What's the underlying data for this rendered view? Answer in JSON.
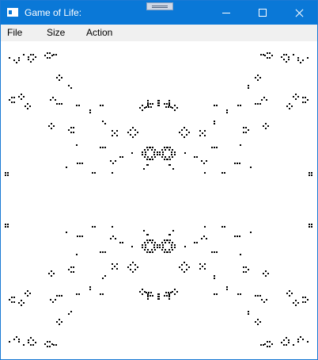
{
  "window": {
    "title": "Game of Life:"
  },
  "menu": {
    "items": [
      "File",
      "Size",
      "Action"
    ]
  },
  "colors": {
    "titlebar": "#0a78d7",
    "border": "#1a7ad4",
    "menubar": "#f0f0f0",
    "board": "#ffffff",
    "cell": "#000000"
  },
  "icons": {
    "app": "app-window-icon",
    "minimize": "minimize-icon",
    "maximize": "maximize-icon",
    "close": "close-icon"
  }
}
